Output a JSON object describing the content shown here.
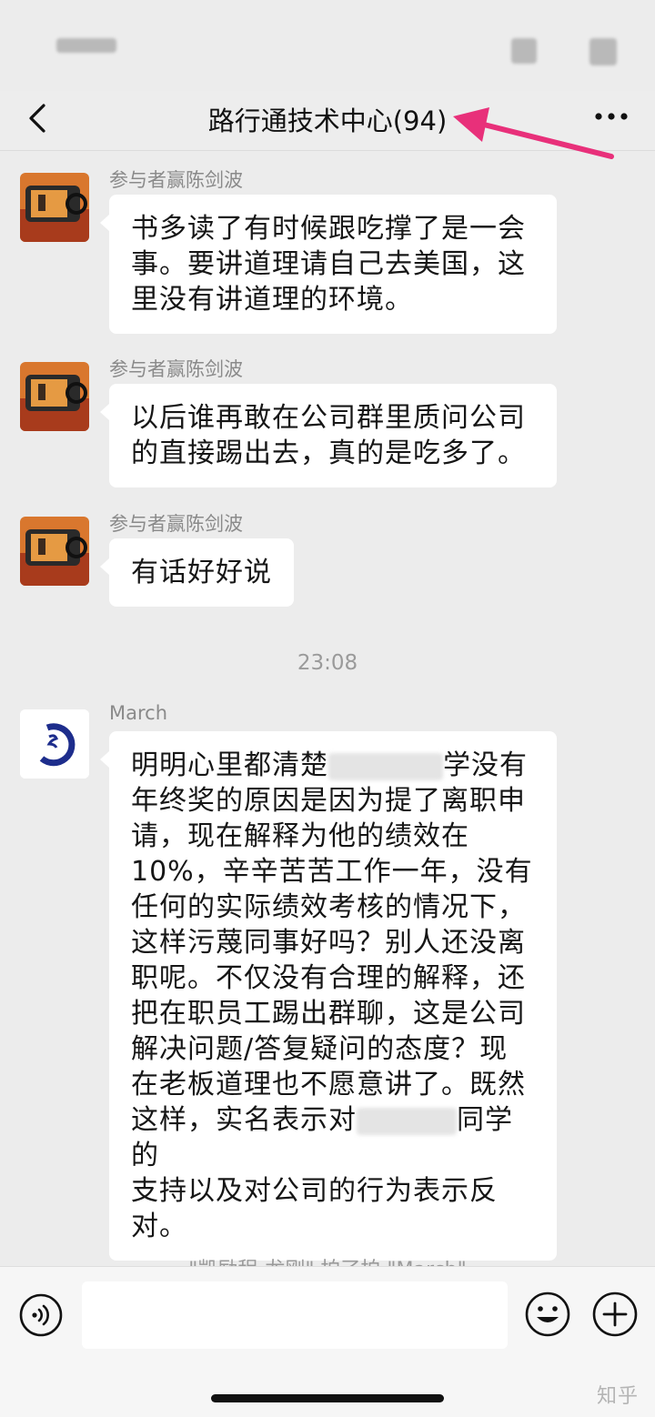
{
  "navbar": {
    "title": "路行通技术中心(94)",
    "back_icon": "chevron-left-icon",
    "more_icon": "ellipsis-icon"
  },
  "messages": [
    {
      "sender": "参与者赢陈剑波",
      "lines": [
        "书多读了有时候跟吃撑了是一会",
        "事。要讲道理请自己去美国，这",
        "里没有讲道理的环境。"
      ]
    },
    {
      "sender": "参与者赢陈剑波",
      "lines": [
        "以后谁再敢在公司群里质问公司",
        "的直接踢出去，真的是吃多了。"
      ]
    },
    {
      "sender": "参与者赢陈剑波",
      "lines": [
        "有话好好说"
      ]
    },
    {
      "sender": "March",
      "lines": [
        "明明心里都清楚",
        "学没有",
        "年终奖的原因是因为提了离职申",
        "请，现在解释为他的绩效在",
        "10%，辛辛苦苦工作一年，没有",
        "任何的实际绩效考核的情况下，",
        "这样污蔑同事好吗？别人还没离",
        "职呢。不仅没有合理的解释，还",
        "把在职员工踢出群聊，这是公司",
        "解决问题/答复疑问的态度？现",
        "在老板道理也不愿意讲了。既然",
        "这样，实名表示对",
        "同学的",
        "支持以及对公司的行为表示反",
        "对。"
      ]
    }
  ],
  "timestamp": "23:08",
  "system_note": "\"凯励程-龙刚\" 拍了拍 \"March\"",
  "inputbar": {
    "voice_icon": "voice-icon",
    "emoji_icon": "emoji-icon",
    "plus_icon": "plus-icon"
  },
  "watermark": "知乎"
}
